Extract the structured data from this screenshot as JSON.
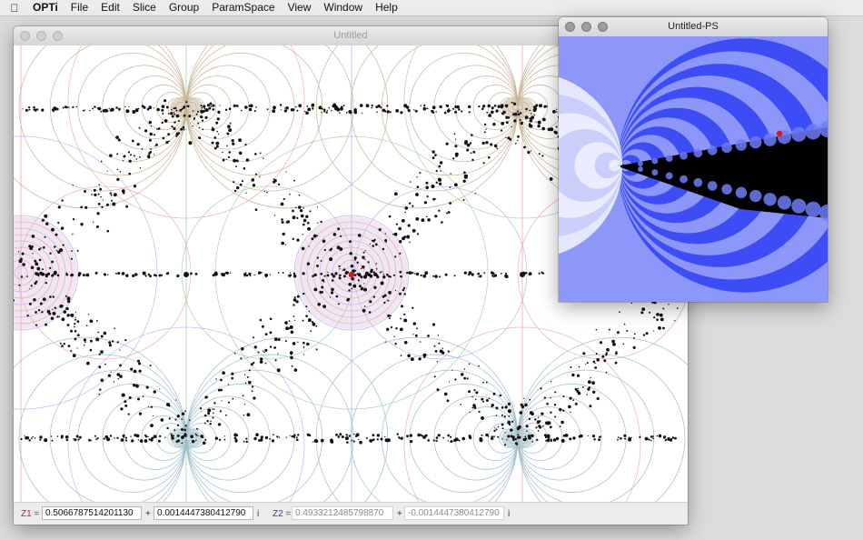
{
  "menubar": {
    "apple_icon": "apple-logo-icon",
    "app_name": "OPTi",
    "items": [
      "File",
      "Edit",
      "Slice",
      "Group",
      "ParamSpace",
      "View",
      "Window",
      "Help"
    ]
  },
  "main_window": {
    "title": "Untitled",
    "status": {
      "z1_label": "Z1",
      "z1_real": "0.5066787514201130",
      "z1_imag": "0.0014447380412790",
      "z2_label": "Z2",
      "z2_real": "0.4933212485798870",
      "z2_imag": "-0.0014447380412790",
      "equals": "=",
      "plus": "+",
      "imag_unit": "i"
    }
  },
  "ps_window": {
    "title": "Untitled-PS"
  },
  "colors": {
    "marker": "#e0141c",
    "ps_dark_blue": "#3d4df5",
    "ps_light_blue": "#8d97f9",
    "circle_red": "#e99aa0",
    "circle_green": "#93c99a",
    "circle_blue": "#a6a8ee",
    "cusp_tan": "#c8b596",
    "cusp_teal": "#9fbecb"
  }
}
